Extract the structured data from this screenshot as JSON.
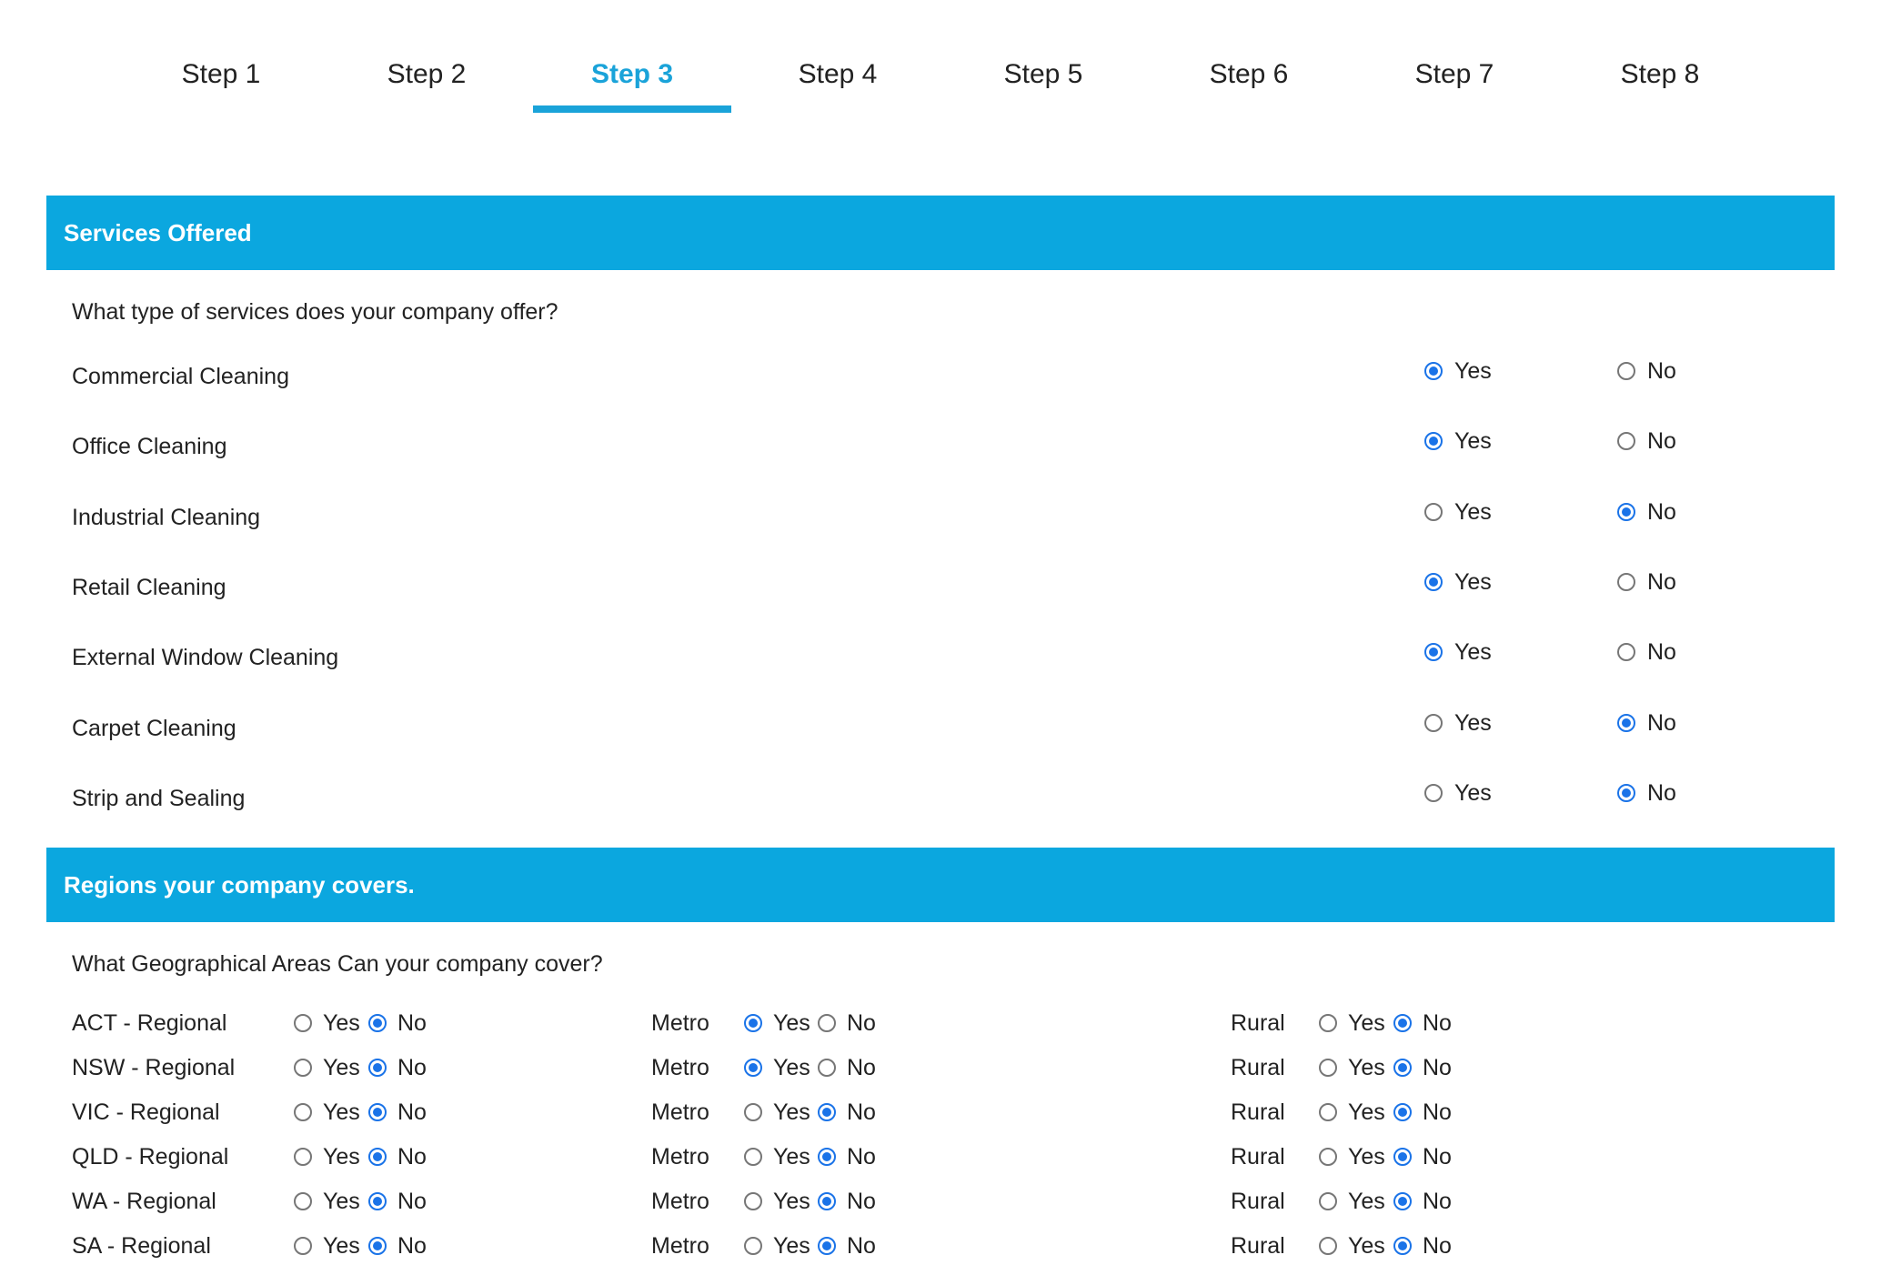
{
  "steps": [
    {
      "label": "Step 1",
      "active": false
    },
    {
      "label": "Step 2",
      "active": false
    },
    {
      "label": "Step 3",
      "active": true
    },
    {
      "label": "Step 4",
      "active": false
    },
    {
      "label": "Step 5",
      "active": false
    },
    {
      "label": "Step 6",
      "active": false
    },
    {
      "label": "Step 7",
      "active": false
    },
    {
      "label": "Step 8",
      "active": false
    }
  ],
  "colors": {
    "accent": "#0ba7df",
    "active_tab": "#1aa3d9",
    "radio_checked": "#1a73e8"
  },
  "services": {
    "header": "Services Offered",
    "question": "What type of services does your company offer?",
    "yes_label": "Yes",
    "no_label": "No",
    "items": [
      {
        "label": "Commercial Cleaning",
        "value": "Yes"
      },
      {
        "label": "Office Cleaning",
        "value": "Yes"
      },
      {
        "label": "Industrial Cleaning",
        "value": "No"
      },
      {
        "label": "Retail Cleaning",
        "value": "Yes"
      },
      {
        "label": "External Window Cleaning",
        "value": "Yes"
      },
      {
        "label": "Carpet Cleaning",
        "value": "No"
      },
      {
        "label": "Strip and Sealing",
        "value": "No"
      }
    ]
  },
  "regions": {
    "header": "Regions your company covers.",
    "question": "What Geographical Areas Can your company cover?",
    "yes_label": "Yes",
    "no_label": "No",
    "metro_label": "Metro",
    "rural_label": "Rural",
    "items": [
      {
        "label": "ACT - Regional",
        "regional": "No",
        "metro": "Yes",
        "rural": "No"
      },
      {
        "label": "NSW - Regional",
        "regional": "No",
        "metro": "Yes",
        "rural": "No"
      },
      {
        "label": "VIC - Regional",
        "regional": "No",
        "metro": "No",
        "rural": "No"
      },
      {
        "label": "QLD - Regional",
        "regional": "No",
        "metro": "No",
        "rural": "No"
      },
      {
        "label": "WA - Regional",
        "regional": "No",
        "metro": "No",
        "rural": "No"
      },
      {
        "label": "SA - Regional",
        "regional": "No",
        "metro": "No",
        "rural": "No"
      }
    ]
  }
}
